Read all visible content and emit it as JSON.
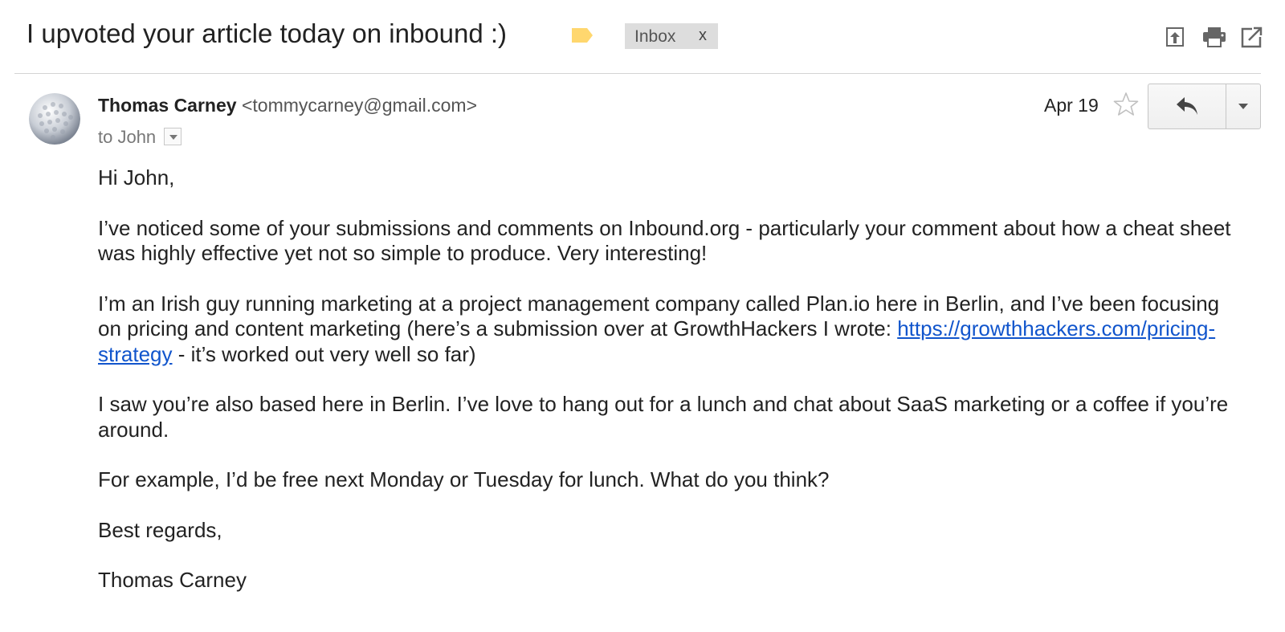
{
  "thread": {
    "subject": "I upvoted your article today on inbound :)",
    "label_color": "#ffd76e",
    "chip": {
      "label": "Inbox",
      "close": "x"
    },
    "toolbar_icons": [
      "archive-up-icon",
      "print-icon",
      "open-new-window-icon"
    ]
  },
  "message": {
    "sender_name": "Thomas Carney",
    "sender_email": "<tommycarney@gmail.com>",
    "recipient": "to John",
    "date": "Apr 19",
    "star_icon": "star-outline-icon",
    "reply_icon": "reply-arrow-icon",
    "more_icon": "chevron-down-icon",
    "body": {
      "greeting": "Hi John,",
      "p1": "I’ve noticed some of your submissions and comments on Inbound.org - particularly your comment about how a cheat sheet was highly effective yet not so simple to produce. Very interesting!",
      "p2_before": "I’m an Irish guy running marketing at a project management company called Plan.io here in Berlin, and I’ve been focusing on pricing and content marketing (here’s a submission over at GrowthHackers I wrote: ",
      "p2_link": "https://growthhackers.com/pricing-strategy",
      "p2_after": " - it’s worked out very well so far)",
      "p3": "I saw you’re also based here in Berlin. I’ve love to hang out for a lunch and chat about SaaS marketing or a coffee if you’re around.",
      "p4": "For example, I’d be free next Monday or Tuesday for lunch. What do you think?",
      "closing": "Best regards,",
      "signature": "Thomas Carney"
    },
    "link_color": "#1155cc"
  }
}
